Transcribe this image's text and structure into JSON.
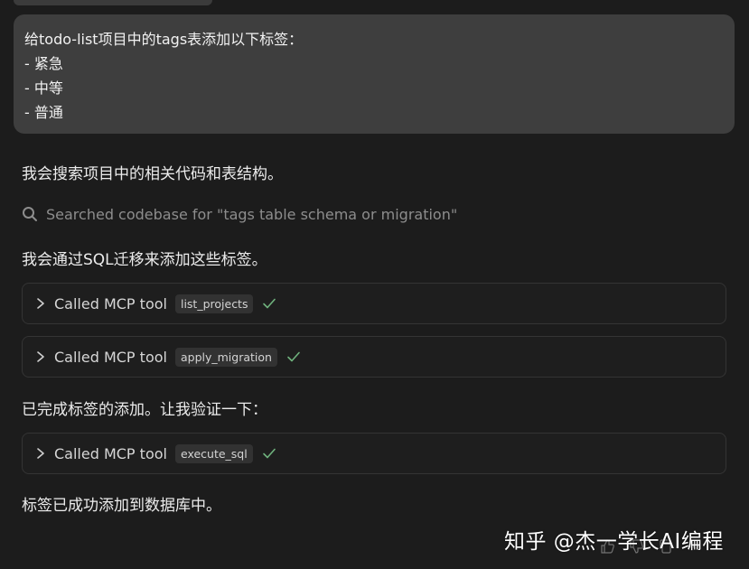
{
  "user_message": {
    "lines": [
      "给todo-list项目中的tags表添加以下标签：",
      "- 紧急",
      "- 中等",
      "- 普通"
    ]
  },
  "assistant": {
    "intro": "我会搜索项目中的相关代码和表结构。",
    "search": {
      "icon": "search-icon",
      "text": "Searched codebase for \"tags table schema or migration\""
    },
    "plan": "我会通过SQL迁移来添加这些标签。",
    "verify": "已完成标签的添加。让我验证一下：",
    "final": "标签已成功添加到数据库中。"
  },
  "tool_calls": [
    {
      "label": "Called MCP tool",
      "tool": "list_projects",
      "status": "success"
    },
    {
      "label": "Called MCP tool",
      "tool": "apply_migration",
      "status": "success"
    },
    {
      "label": "Called MCP tool",
      "tool": "execute_sql",
      "status": "success"
    }
  ],
  "watermark": "知乎 @杰一学长AI编程",
  "colors": {
    "background": "#1c1c1c",
    "user_bubble": "#3e3e3e",
    "check": "#6fb27d",
    "muted_text": "#8d8d8d"
  },
  "icons": {
    "chevron": "chevron-right-icon",
    "check": "checkmark-icon",
    "thumbs_up": "thumbs-up-icon",
    "thumbs_down": "thumbs-down-icon",
    "copy": "copy-icon",
    "more": "more-icon"
  }
}
